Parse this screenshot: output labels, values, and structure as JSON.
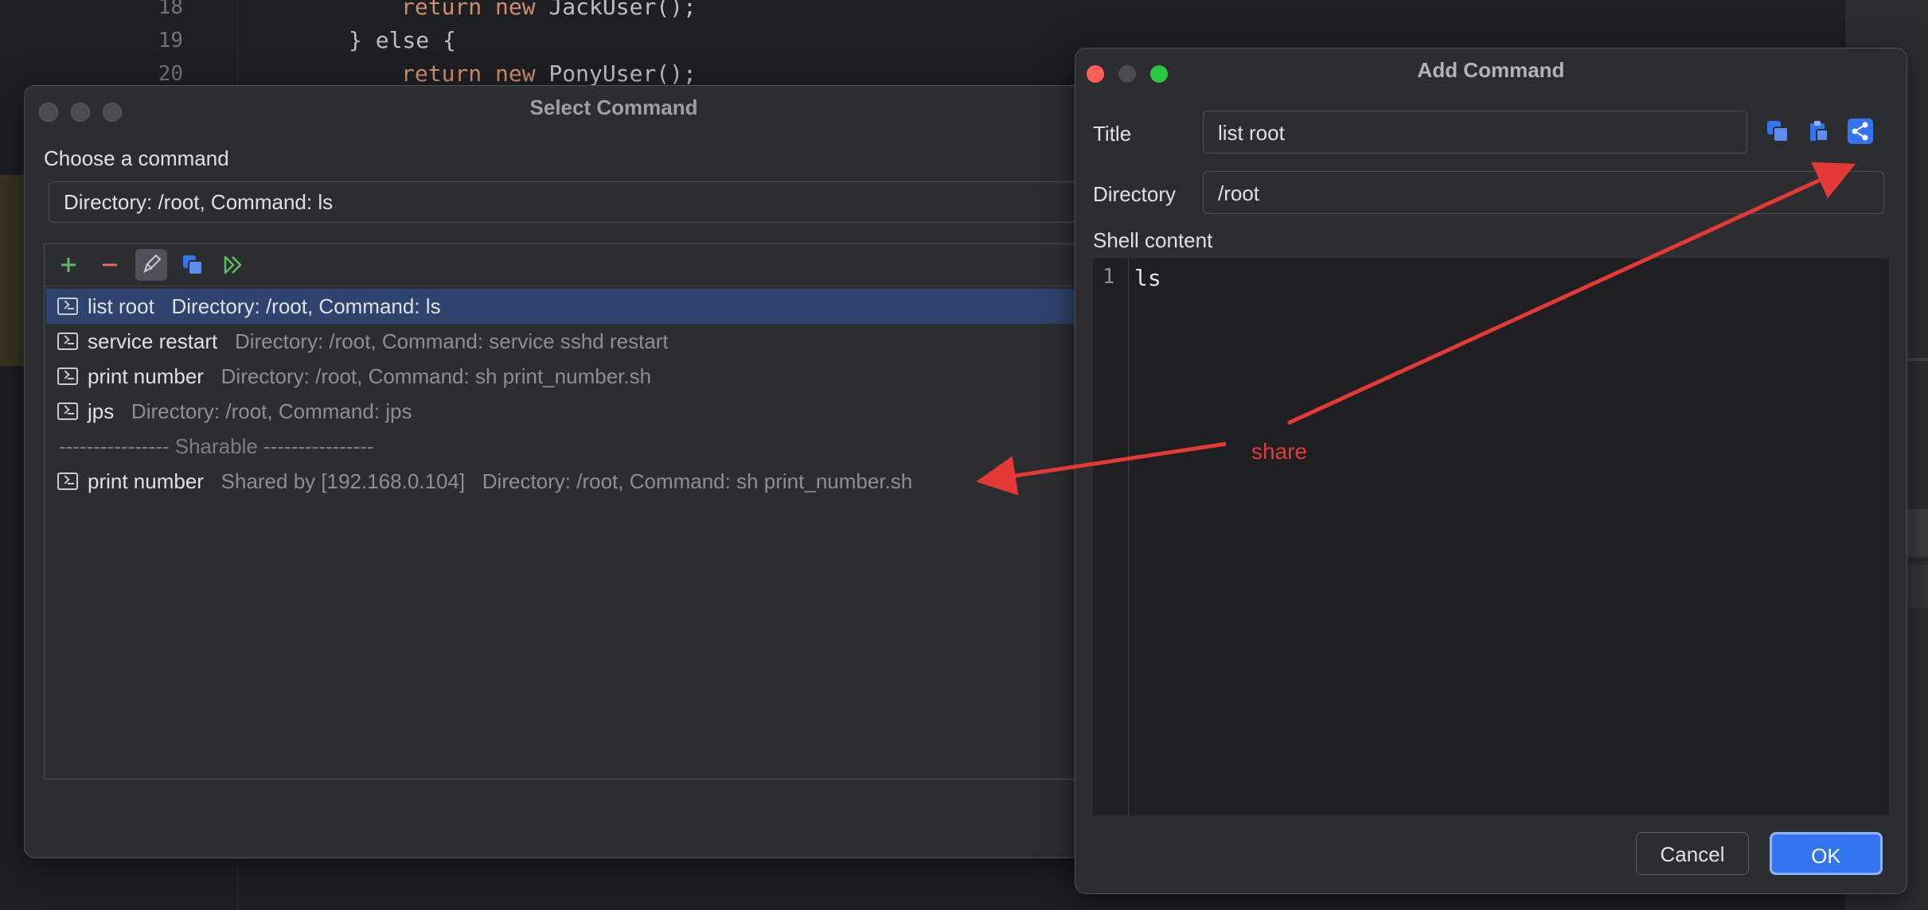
{
  "editor": {
    "lines": [
      {
        "num": "18",
        "indent": "    ",
        "kw": "return new",
        "rest": " JackUser();"
      },
      {
        "num": "19",
        "indent": "",
        "kw": "",
        "rest": "} else {"
      },
      {
        "num": "20",
        "indent": "    ",
        "kw": "return new",
        "rest": " PonyUser();"
      }
    ],
    "else_kw": "else"
  },
  "select_window": {
    "title": "Select Command",
    "choose_label": "Choose a command",
    "combo_value": "Directory: /root, Command: ls",
    "toolbar": {
      "add_icon": "plus-icon",
      "remove_icon": "minus-icon",
      "edit_icon": "pencil-icon",
      "copy_icon": "copy-icon",
      "run_icon": "run-icon"
    },
    "items": [
      {
        "title": "list root",
        "desc": "Directory: /root, Command: ls",
        "selected": true
      },
      {
        "title": "service restart",
        "desc": "Directory: /root, Command: service sshd restart"
      },
      {
        "title": "print number",
        "desc": "Directory: /root, Command: sh print_number.sh"
      },
      {
        "title": "jps",
        "desc": "Directory: /root, Command: jps"
      }
    ],
    "separator": "---------------- Sharable ----------------",
    "shared_items": [
      {
        "title": "print number",
        "shared_by": "Shared by [192.168.0.104]",
        "desc": "Directory: /root, Command: sh print_number.sh"
      }
    ]
  },
  "add_window": {
    "title": "Add Command",
    "title_label": "Title",
    "title_value": "list root",
    "directory_label": "Directory",
    "directory_value": "/root",
    "shell_label": "Shell content",
    "shell_line_number": "1",
    "shell_code": "ls",
    "icons": [
      "copy-icon",
      "paste-icon",
      "share-icon"
    ],
    "cancel_label": "Cancel",
    "ok_label": "OK"
  },
  "annotation": {
    "label": "share",
    "color": "#e53935"
  },
  "colors": {
    "accent": "#3574f0",
    "selection": "#2e436e",
    "add_green": "#5fb865",
    "remove_red": "#e06c5c"
  }
}
